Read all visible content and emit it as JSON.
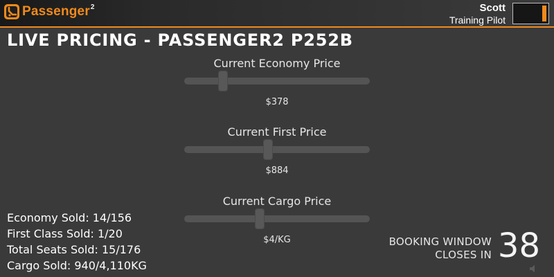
{
  "app": {
    "brand_name": "Passenger",
    "brand_superscript": "2",
    "brand_color": "#f08a1c",
    "icon": "passenger-logo-icon"
  },
  "user": {
    "name": "Scott",
    "role": "Training Pilot",
    "level_fraction": 0.12
  },
  "page": {
    "title": "LIVE PRICING - PASSENGER2 P252B"
  },
  "pricing": [
    {
      "label": "Current Economy Price",
      "value": "$378",
      "slider_fraction": 0.21
    },
    {
      "label": "Current First Price",
      "value": "$884",
      "slider_fraction": 0.45
    },
    {
      "label": "Current Cargo Price",
      "value": "$4/KG",
      "slider_fraction": 0.405
    }
  ],
  "stats": [
    "Economy Sold: 14/156",
    "First Class Sold: 1/20",
    "Total Seats Sold: 15/176",
    "Cargo Sold: 940/4,110KG"
  ],
  "booking": {
    "line1": "BOOKING WINDOW",
    "line2": "CLOSES IN",
    "countdown": "38"
  },
  "icons": {
    "sound": "speaker-icon"
  }
}
